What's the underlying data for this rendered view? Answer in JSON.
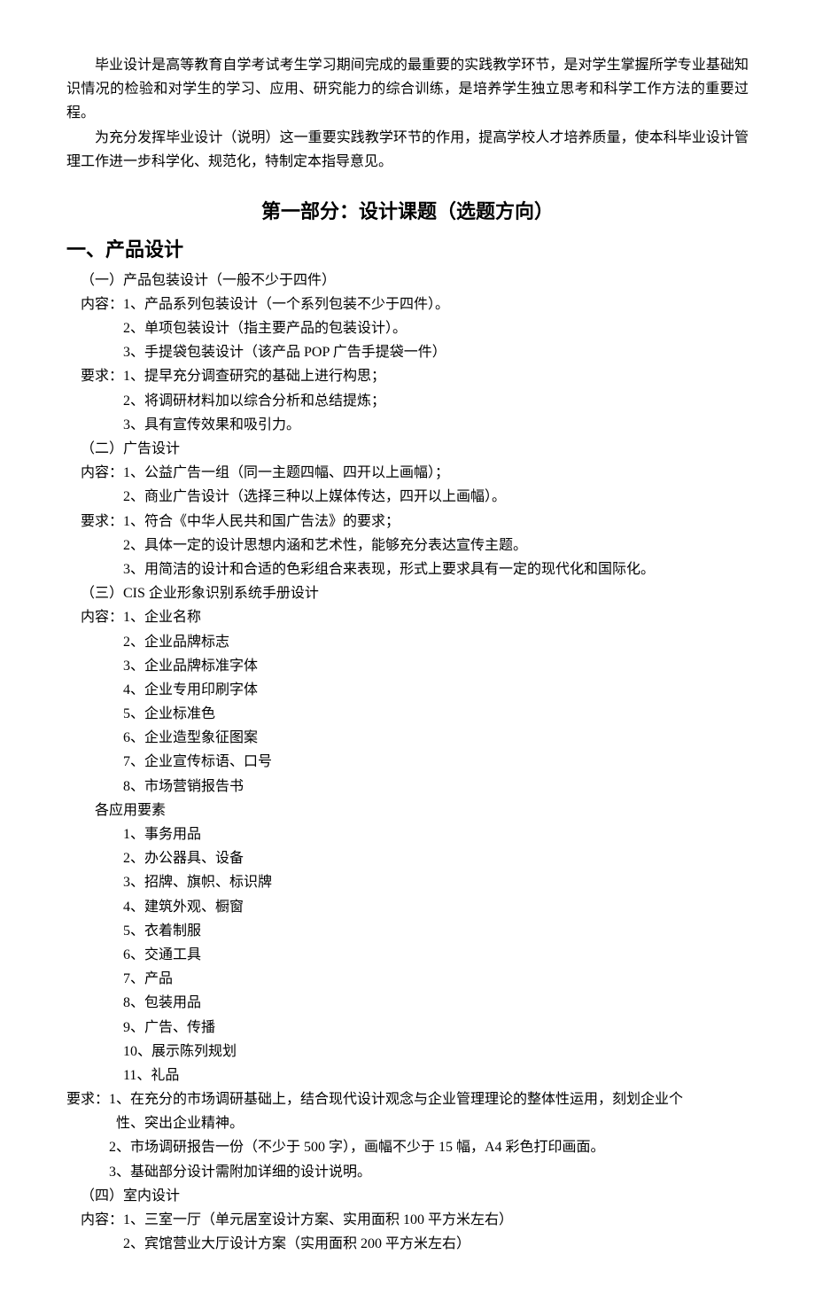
{
  "intro": {
    "p1": "毕业设计是高等教育自学考试考生学习期间完成的最重要的实践教学环节，是对学生掌握所学专业基础知识情况的检验和对学生的学习、应用、研究能力的综合训练，是培养学生独立思考和科学工作方法的重要过程。",
    "p2": "为充分发挥毕业设计（说明）这一重要实践教学环节的作用，提高学校人才培养质量，使本科毕业设计管理工作进一步科学化、规范化，特制定本指导意见。"
  },
  "section_heading": "第一部分：设计课题（选题方向）",
  "subheading": "一、产品设计",
  "lines": [
    "（一）产品包装设计（一般不少于四件）",
    "内容：1、产品系列包装设计（一个系列包装不少于四件）。",
    "2、单项包装设计（指主要产品的包装设计）。",
    "3、手提袋包装设计（该产品 POP 广告手提袋一件）",
    "要求：1、提早充分调查研究的基础上进行构思；",
    "2、将调研材料加以综合分析和总结提炼；",
    "3、具有宣传效果和吸引力。",
    "（二）广告设计",
    "内容：1、公益广告一组（同一主题四幅、四开以上画幅）；",
    "2、商业广告设计（选择三种以上媒体传达，四开以上画幅）。",
    "要求：1、符合《中华人民共和国广告法》的要求；",
    "2、具体一定的设计思想内涵和艺术性，能够充分表达宣传主题。",
    "3、用简洁的设计和合适的色彩组合来表现，形式上要求具有一定的现代化和国际化。",
    "（三）CIS 企业形象识别系统手册设计",
    "内容：1、企业名称",
    "2、企业品牌标志",
    "3、企业品牌标准字体",
    "4、企业专用印刷字体",
    "5、企业标准色",
    "6、企业造型象征图案",
    "7、企业宣传标语、口号",
    "8、市场营销报告书",
    "各应用要素",
    "1、事务用品",
    "2、办公器具、设备",
    "3、招牌、旗帜、标识牌",
    "4、建筑外观、橱窗",
    "5、衣着制服",
    "6、交通工具",
    "7、产品",
    "8、包装用品",
    "9、广告、传播",
    "10、展示陈列规划",
    "11、礼品",
    "要求：1、在充分的市场调研基础上，结合现代设计观念与企业管理理论的整体性运用，刻划企业个",
    "性、突出企业精神。",
    "2、市场调研报告一份（不少于 500 字），画幅不少于 15 幅，A4 彩色打印画面。",
    "3、基础部分设计需附加详细的设计说明。",
    "（四）室内设计",
    "内容：1、三室一厅（单元居室设计方案、实用面积 100 平方米左右）",
    "2、宾馆营业大厅设计方案（实用面积 200 平方米左右）"
  ],
  "indents": [
    "indent1",
    "indent1",
    "indent4",
    "indent4",
    "indent1",
    "indent4",
    "indent4",
    "indent1",
    "indent1",
    "indent4",
    "indent1",
    "indent4",
    "indent4",
    "indent1",
    "indent1",
    "indent4",
    "indent4",
    "indent4",
    "indent4",
    "indent4",
    "indent4",
    "indent4",
    "indent2",
    "indent4",
    "indent4",
    "indent4",
    "indent4",
    "indent4",
    "indent4",
    "indent4",
    "indent4",
    "indent4",
    "indent4",
    "indent4",
    "indent0",
    "indent3h",
    "indent3",
    "indent3",
    "indent1",
    "indent1",
    "indent4"
  ]
}
